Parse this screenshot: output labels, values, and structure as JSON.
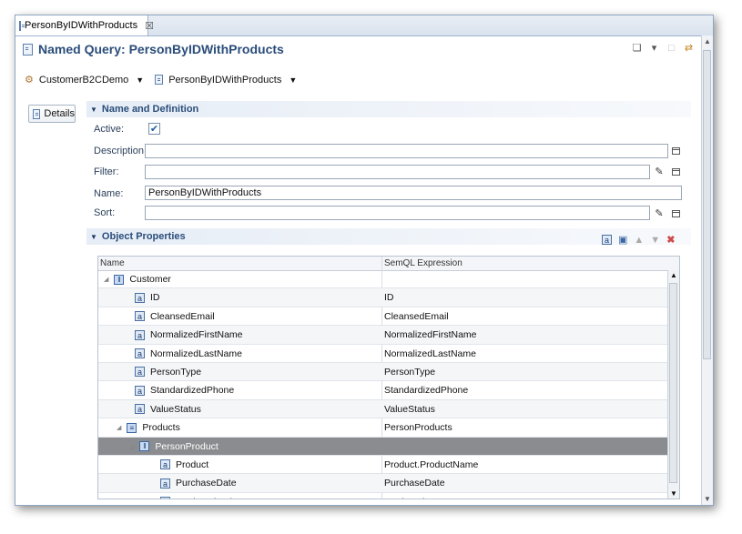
{
  "editor_tab": {
    "label": "PersonByIDWithProducts",
    "close": "☒"
  },
  "header": {
    "title": "Named Query: PersonByIDWithProducts"
  },
  "breadcrumb": {
    "model": "CustomerB2CDemo",
    "query": "PersonByIDWithProducts"
  },
  "side_nav": {
    "details_label": "Details"
  },
  "name_definition": {
    "section_title": "Name and Definition",
    "active_label": "Active:",
    "active_checked": true,
    "description_label": "Description:",
    "description_value": "",
    "filter_label": "Filter:",
    "filter_value": "",
    "name_label": "Name:",
    "name_value": "PersonByIDWithProducts",
    "sort_label": "Sort:",
    "sort_value": ""
  },
  "object_properties": {
    "section_title": "Object Properties",
    "columns": [
      "Name",
      "SemQL Expression"
    ],
    "rows": [
      {
        "name": "Customer",
        "expr": "",
        "kind": "entity",
        "level": 0
      },
      {
        "name": "ID",
        "expr": "ID",
        "kind": "attribute",
        "level": 1
      },
      {
        "name": "CleansedEmail",
        "expr": "CleansedEmail",
        "kind": "attribute",
        "level": 1
      },
      {
        "name": "NormalizedFirstName",
        "expr": "NormalizedFirstName",
        "kind": "attribute",
        "level": 1
      },
      {
        "name": "NormalizedLastName",
        "expr": "NormalizedLastName",
        "kind": "attribute",
        "level": 1
      },
      {
        "name": "PersonType",
        "expr": "PersonType",
        "kind": "attribute",
        "level": 1
      },
      {
        "name": "StandardizedPhone",
        "expr": "StandardizedPhone",
        "kind": "attribute",
        "level": 1
      },
      {
        "name": "ValueStatus",
        "expr": "ValueStatus",
        "kind": "attribute",
        "level": 1
      },
      {
        "name": "Products",
        "expr": "PersonProducts",
        "kind": "collection",
        "level": 1
      },
      {
        "name": "PersonProduct",
        "expr": "",
        "kind": "entity",
        "level": 2,
        "selected": true
      },
      {
        "name": "Product",
        "expr": "Product.ProductName",
        "kind": "attribute",
        "level": 3
      },
      {
        "name": "PurchaseDate",
        "expr": "PurchaseDate",
        "kind": "attribute",
        "level": 3
      },
      {
        "name": "Registrationdate",
        "expr": "RegistrationDate",
        "kind": "attribute",
        "level": 3
      }
    ]
  }
}
